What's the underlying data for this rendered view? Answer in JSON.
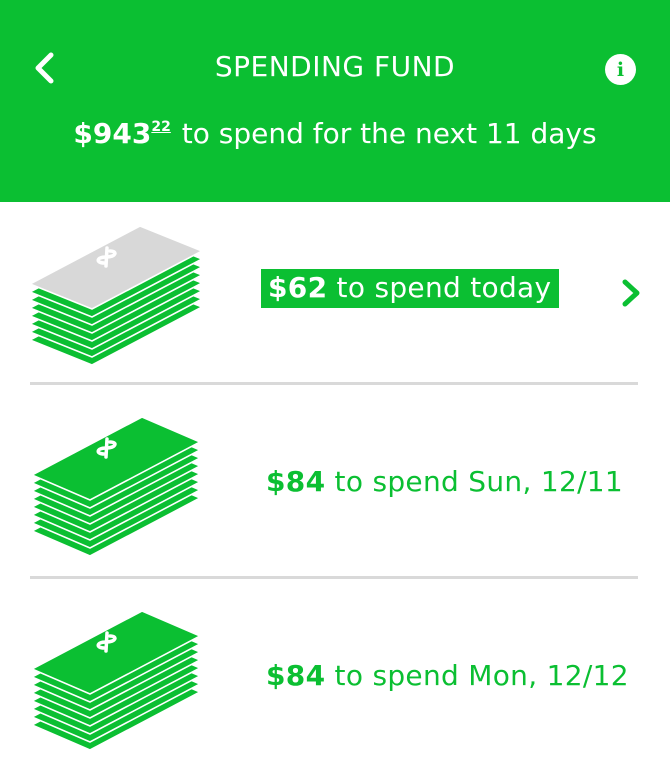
{
  "header": {
    "title": "SPENDING FUND",
    "summary": {
      "dollars": "$943",
      "cents": "22",
      "rest": " to spend for the next 11 days"
    }
  },
  "days": [
    {
      "amount": "$62",
      "text": " to spend today",
      "active": true
    },
    {
      "amount": "$84",
      "text": " to spend Sun, 12/11",
      "active": false
    },
    {
      "amount": "$84",
      "text": " to spend Mon, 12/12",
      "active": false
    }
  ],
  "colors": {
    "brand": "#0bbf32",
    "spent_bill": "#d8d8d8",
    "divider": "#d9d9d9"
  },
  "icons": {
    "back": "chevron-left-icon",
    "info": "info-icon",
    "row_nav": "chevron-right-icon",
    "money": "money-stack-icon"
  }
}
